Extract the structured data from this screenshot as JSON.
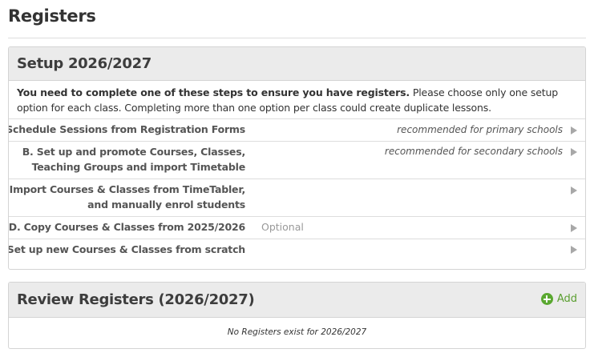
{
  "page": {
    "title": "Registers"
  },
  "setup": {
    "title": "Setup 2026/2027",
    "intro_bold": "You need to complete one of these steps to ensure you have registers.",
    "intro_rest": " Please choose only one setup option for each class. Completing more than one option per class could create duplicate lessons.",
    "options": [
      {
        "label_line1": "A. Schedule Sessions from Registration Forms",
        "label_line2": "",
        "note": "recommended for primary schools",
        "tag": ""
      },
      {
        "label_line1": "B. Set up and promote Courses, Classes,",
        "label_line2": "Teaching Groups and import Timetable",
        "note": "recommended for secondary schools",
        "tag": ""
      },
      {
        "label_line1": "C. Import Courses & Classes from TimeTabler,",
        "label_line2": "and manually enrol students",
        "note": "",
        "tag": ""
      },
      {
        "label_line1": "D. Copy Courses & Classes from 2025/2026",
        "label_line2": "",
        "note": "",
        "tag": "Optional"
      },
      {
        "label_line1": "E. Set up new Courses & Classes from scratch",
        "label_line2": "",
        "note": "",
        "tag": ""
      }
    ]
  },
  "review": {
    "title": "Review Registers (2026/2027)",
    "add_label": "Add",
    "empty_message": "No Registers exist for 2026/2027"
  },
  "colors": {
    "add_green": "#5aa830",
    "panel_header": "#ebebeb",
    "arrow": "#a8a8a8"
  }
}
